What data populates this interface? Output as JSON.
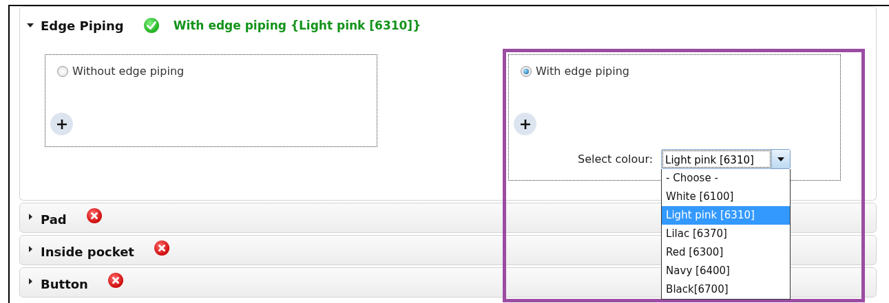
{
  "sections": [
    {
      "title": "Edge Piping",
      "expanded": true,
      "complete": true,
      "summary": "With edge piping {Light pink [6310]}",
      "options": [
        {
          "label": "Without edge piping",
          "selected": false,
          "highlighted": false
        },
        {
          "label": "With edge piping",
          "selected": true,
          "highlighted": true,
          "colour_field": {
            "label": "Select colour:",
            "value": "Light pink [6310]",
            "open": true,
            "list": [
              {
                "label": "- Choose -",
                "selected": false
              },
              {
                "label": "White [6100]",
                "selected": false
              },
              {
                "label": "Light pink [6310]",
                "selected": true
              },
              {
                "label": "Lilac [6370]",
                "selected": false
              },
              {
                "label": "Red [6300]",
                "selected": false
              },
              {
                "label": "Navy [6400]",
                "selected": false
              },
              {
                "label": "Black[6700]",
                "selected": false
              }
            ]
          }
        }
      ]
    },
    {
      "title": "Pad",
      "expanded": false,
      "complete": false
    },
    {
      "title": "Inside pocket",
      "expanded": false,
      "complete": false
    },
    {
      "title": "Button",
      "expanded": false,
      "complete": false
    }
  ]
}
